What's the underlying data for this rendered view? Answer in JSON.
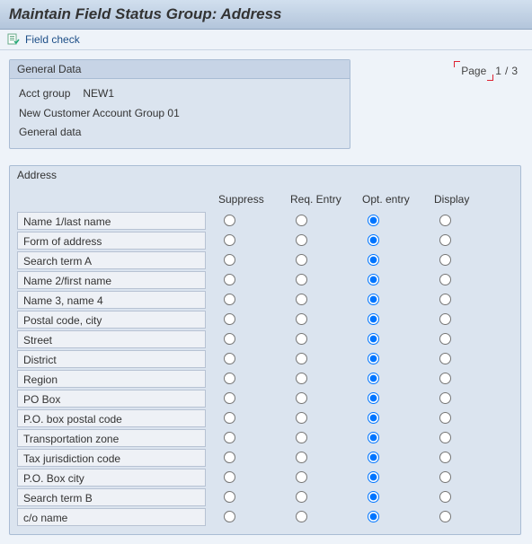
{
  "title": "Maintain Field Status Group: Address",
  "toolbar": {
    "field_check": "Field check"
  },
  "page": {
    "label": "Page",
    "current": "1",
    "sep": "/",
    "total": "3"
  },
  "general": {
    "title": "General Data",
    "acct_label": "Acct group",
    "acct_value": "NEW1",
    "line2": "New Customer Account Group 01",
    "line3": "General data"
  },
  "section_title": "Address",
  "columns": [
    "Suppress",
    "Req. Entry",
    "Opt. entry",
    "Display"
  ],
  "rows": [
    {
      "label": "Name 1/last name",
      "sel": 2
    },
    {
      "label": "Form of address",
      "sel": 2
    },
    {
      "label": "Search term A",
      "sel": 2
    },
    {
      "label": "Name 2/first name",
      "sel": 2
    },
    {
      "label": "Name 3, name 4",
      "sel": 2
    },
    {
      "label": "Postal code, city",
      "sel": 2
    },
    {
      "label": "Street",
      "sel": 2
    },
    {
      "label": "District",
      "sel": 2
    },
    {
      "label": "Region",
      "sel": 2
    },
    {
      "label": "PO Box",
      "sel": 2
    },
    {
      "label": "P.O. box postal code",
      "sel": 2
    },
    {
      "label": "Transportation zone",
      "sel": 2
    },
    {
      "label": "Tax jurisdiction code",
      "sel": 2
    },
    {
      "label": "P.O. Box city",
      "sel": 2
    },
    {
      "label": "Search term B",
      "sel": 2
    },
    {
      "label": "c/o name",
      "sel": 2
    }
  ]
}
